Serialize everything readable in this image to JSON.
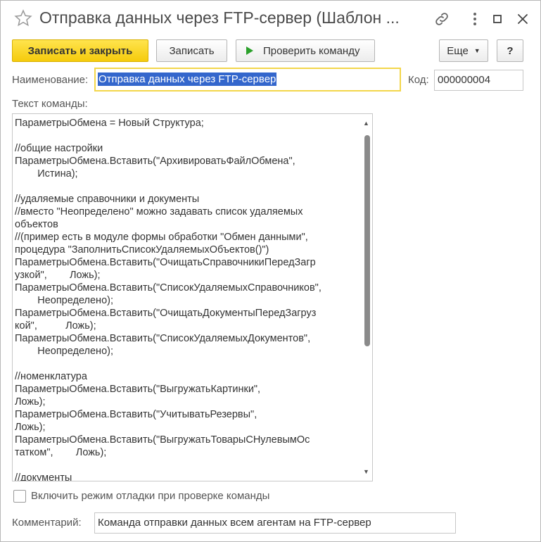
{
  "window": {
    "title": "Отправка данных через FTP-сервер (Шаблон ..."
  },
  "toolbar": {
    "save_close": "Записать и закрыть",
    "save": "Записать",
    "check": "Проверить команду",
    "more": "Еще",
    "help": "?"
  },
  "form": {
    "name_label": "Наименование:",
    "name_value": "Отправка данных через FTP-сервер",
    "code_label": "Код:",
    "code_value": "000000004",
    "text_label": "Текст команды:",
    "command_text": "ПараметрыОбмена = Новый Структура;\n\n//общие настройки\nПараметрыОбмена.Вставить(\"АрхивироватьФайлОбмена\",\n        Истина);\n\n//удаляемые справочники и документы\n//вместо \"Неопределено\" можно задавать список удаляемых\nобъектов\n//(пример есть в модуле формы обработки \"Обмен данными\",\nпроцедура \"ЗаполнитьСписокУдаляемыхОбъектов()\")\nПараметрыОбмена.Вставить(\"ОчищатьСправочникиПередЗагр\nузкой\",        Ложь);\nПараметрыОбмена.Вставить(\"СписокУдаляемыхСправочников\",\n        Неопределено);\nПараметрыОбмена.Вставить(\"ОчищатьДокументыПередЗагруз\nкой\",          Ложь);\nПараметрыОбмена.Вставить(\"СписокУдаляемыхДокументов\",\n        Неопределено);\n\n//номенклатура\nПараметрыОбмена.Вставить(\"ВыгружатьКартинки\",\nЛожь);\nПараметрыОбмена.Вставить(\"УчитыватьРезервы\",\nЛожь);\nПараметрыОбмена.Вставить(\"ВыгружатьТоварыСНулевымОс\nтатком\",        Ложь);\n\n//документы",
    "debug_label": "Включить режим отладки при проверке команды",
    "comment_label": "Комментарий:",
    "comment_value": "Команда отправки данных всем агентам на FTP-сервер"
  },
  "colors": {
    "primary_button": "#f5cb0c",
    "focus_border": "#f3d64a",
    "selection": "#3366cc",
    "check_icon": "#2aa02a"
  },
  "icons": [
    "star-icon",
    "link-icon",
    "more-vertical-icon",
    "maximize-icon",
    "close-icon",
    "play-icon"
  ]
}
